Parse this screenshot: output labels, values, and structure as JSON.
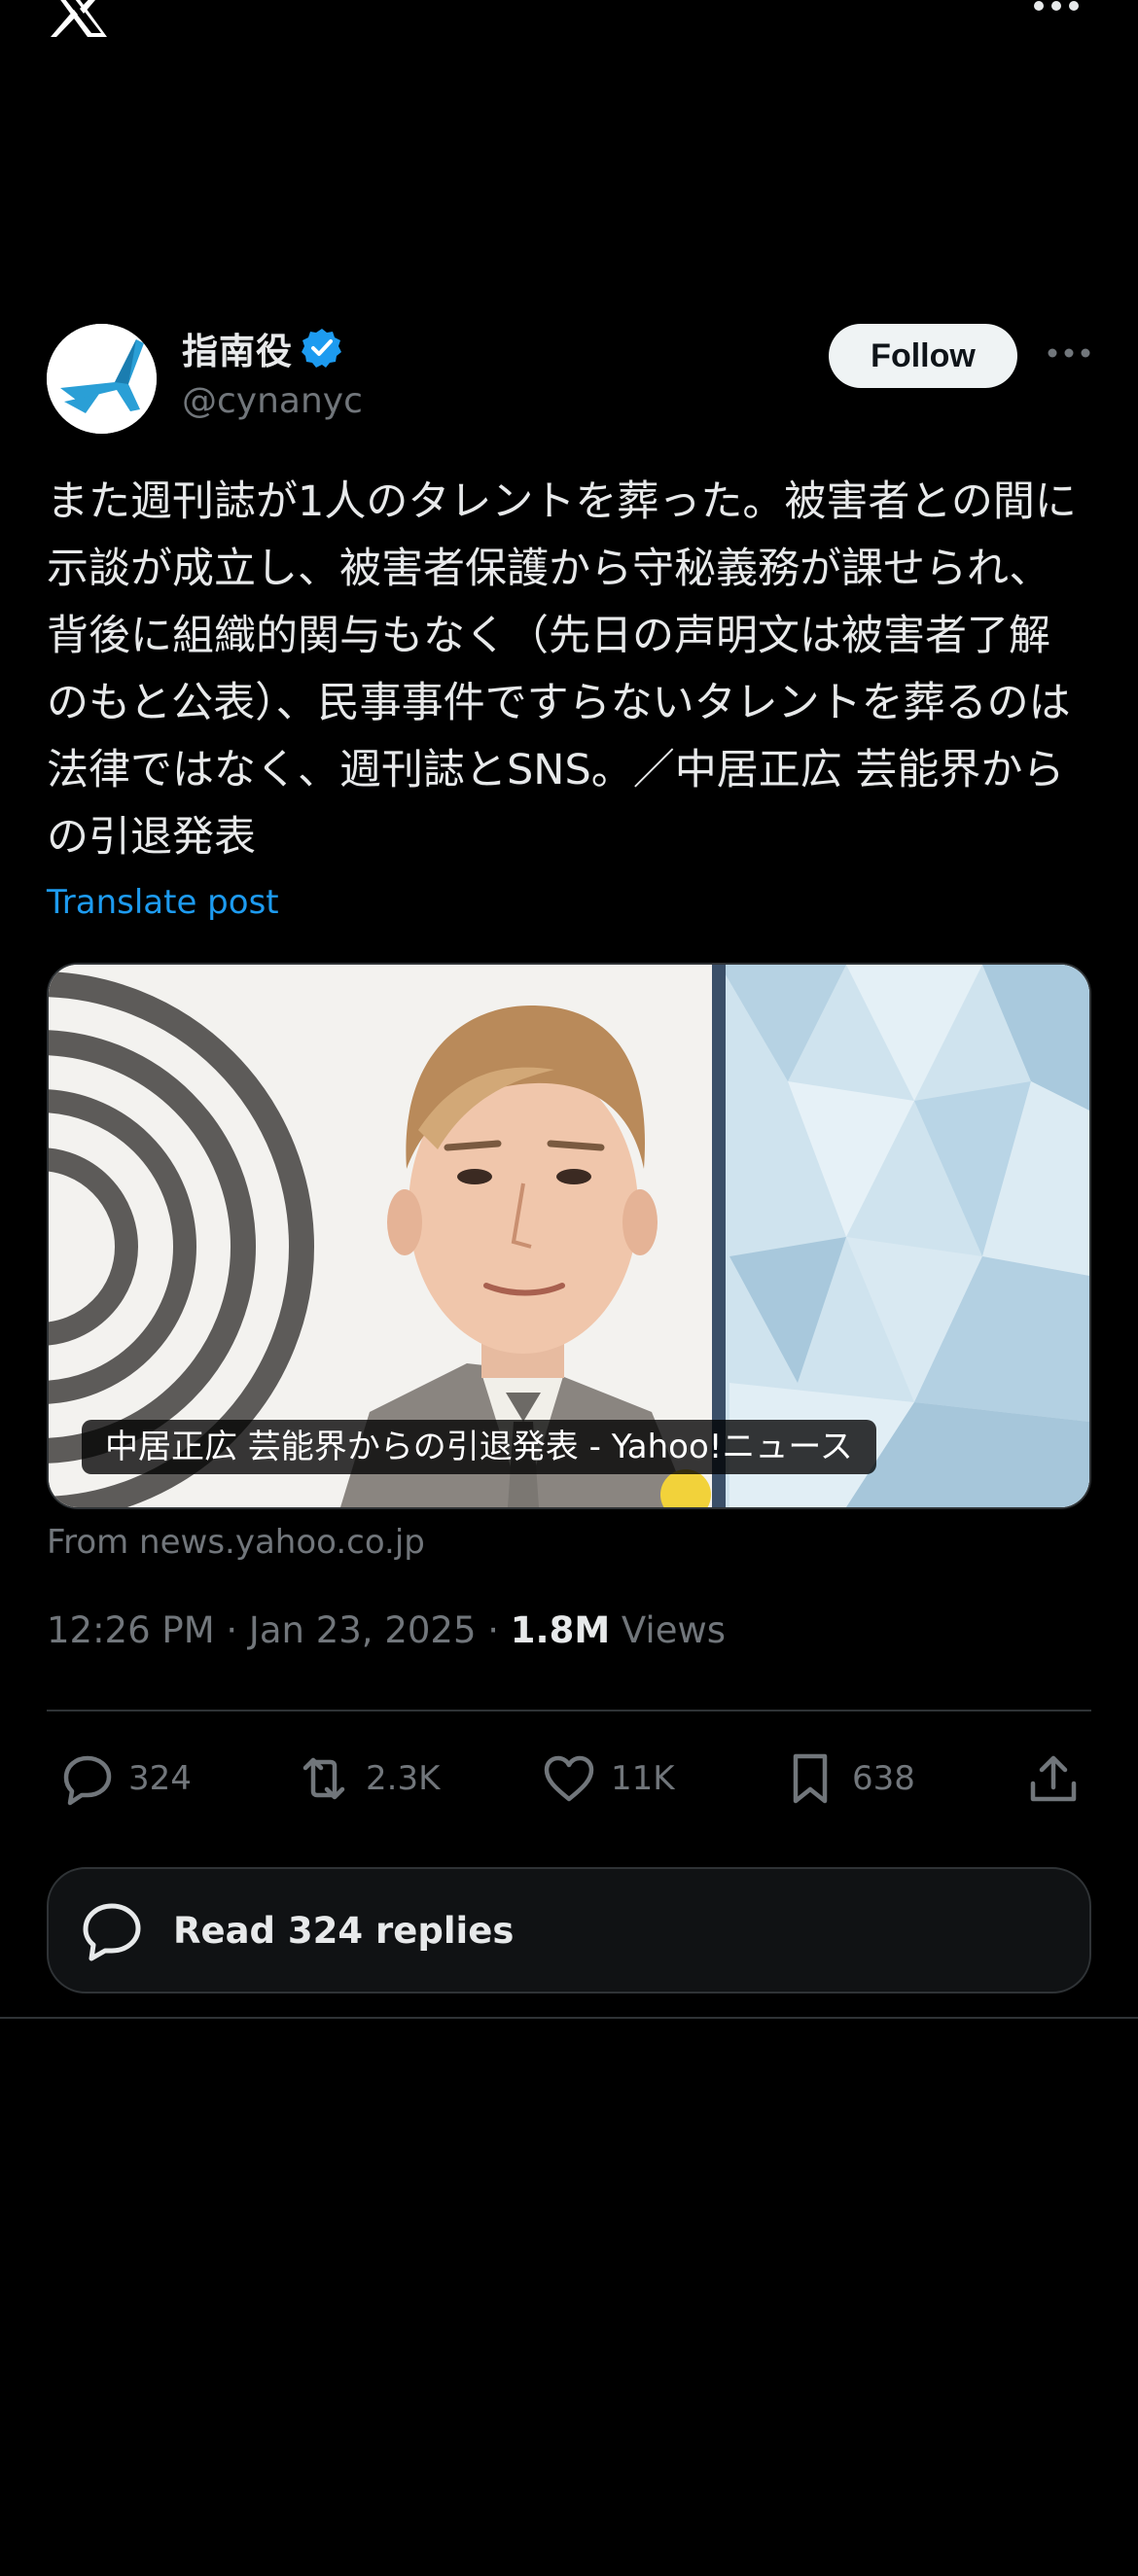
{
  "app": {
    "logo": "x-logo",
    "menu_icon": "more-icon"
  },
  "tweet": {
    "author": {
      "display_name": "指南役",
      "handle": "@cynanyc",
      "verified": true,
      "avatar": "avatar-airplane-logo"
    },
    "follow_label": "Follow",
    "text": "また週刊誌が1人のタレントを葬った。被害者との間に示談が成立し、被害者保護から守秘義務が課せられ、背後に組織的関与もなく（先日の声明文は被害者了解のもと公表）、民事事件ですらないタレントを葬るのは法律ではなく、週刊誌とSNS。／中居正広 芸能界からの引退発表",
    "translate_label": "Translate post",
    "card": {
      "title": "中居正広 芸能界からの引退発表 - Yahoo!ニュース",
      "source": "From news.yahoo.co.jp"
    },
    "meta": {
      "time": "12:26 PM",
      "date": "Jan 23, 2025",
      "views_count": "1.8M",
      "views_label": "Views"
    },
    "actions": {
      "replies": "324",
      "reposts": "2.3K",
      "likes": "11K",
      "bookmarks": "638"
    },
    "read_replies_label": "Read 324 replies"
  },
  "colors": {
    "background": "#000000",
    "text": "#e7e9ea",
    "muted": "#71767b",
    "accent": "#1d9bf0",
    "border": "#2f3336"
  }
}
